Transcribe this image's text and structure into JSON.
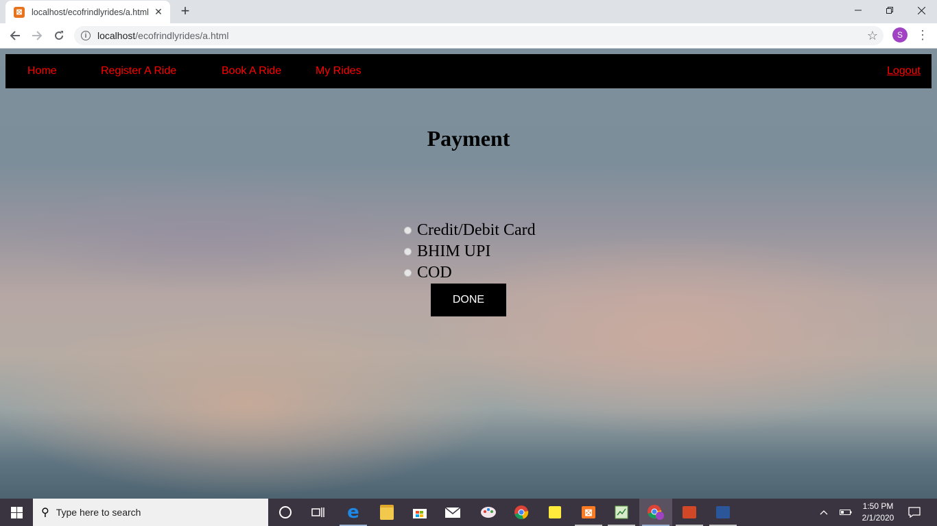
{
  "browser": {
    "tab_title": "localhost/ecofrindlyrides/a.html",
    "tab_close": "✕",
    "new_tab": "+",
    "url_host": "localhost",
    "url_path": "/ecofrindlyrides/a.html",
    "avatar_letter": "S"
  },
  "site_nav": {
    "links": [
      "Home",
      "Register A Ride",
      "Book A Ride",
      "My Rides"
    ],
    "logout": "Logout",
    "link_color": "#ff0000",
    "bg_color": "#000000"
  },
  "payment": {
    "title": "Payment",
    "options": [
      "Credit/Debit Card",
      "BHIM UPI",
      "COD"
    ],
    "done_label": "DONE"
  },
  "taskbar": {
    "search_placeholder": "Type here to search",
    "time": "1:50 PM",
    "date": "2/1/2020",
    "icons": [
      "cortana-icon",
      "task-view-icon",
      "edge-icon",
      "file-explorer-icon",
      "store-icon",
      "mail-icon",
      "paint-icon",
      "chrome-icon",
      "sticky-notes-icon",
      "xampp-icon",
      "notepad-icon",
      "chrome-profile-icon",
      "powerpoint-icon",
      "word-icon"
    ]
  }
}
